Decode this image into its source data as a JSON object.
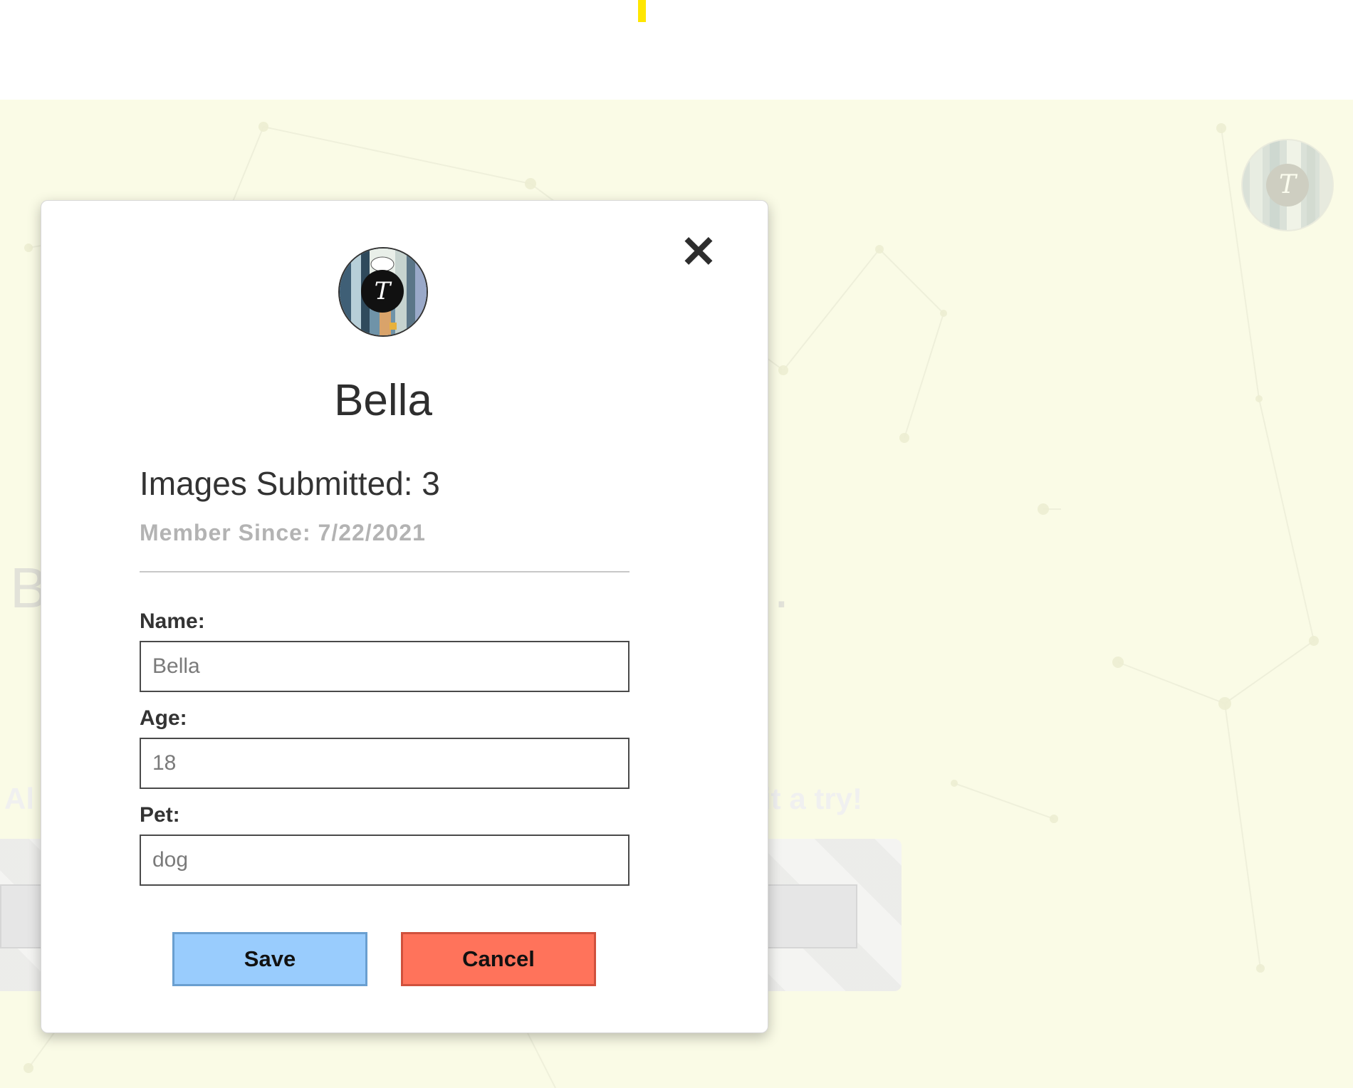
{
  "background": {
    "heading_left": "B",
    "heading_right": "..",
    "subheading_left": "Al",
    "subheading_right": "it a try!"
  },
  "header_avatar": {
    "letter": "T"
  },
  "modal": {
    "close_icon": "close-icon",
    "avatar": {
      "letter": "T"
    },
    "name": "Bella",
    "images_submitted": "Images Submitted: 3",
    "member_since": "Member Since: 7/22/2021",
    "fields": {
      "name": {
        "label": "Name:",
        "value": "Bella"
      },
      "age": {
        "label": "Age:",
        "value": "18"
      },
      "pet": {
        "label": "Pet:",
        "value": "dog"
      }
    },
    "buttons": {
      "save": "Save",
      "cancel": "Cancel"
    }
  },
  "colors": {
    "background": "#fafbe6",
    "accent": "#ffe600",
    "save_button": "#99ccfd",
    "cancel_button": "#ff735b"
  }
}
